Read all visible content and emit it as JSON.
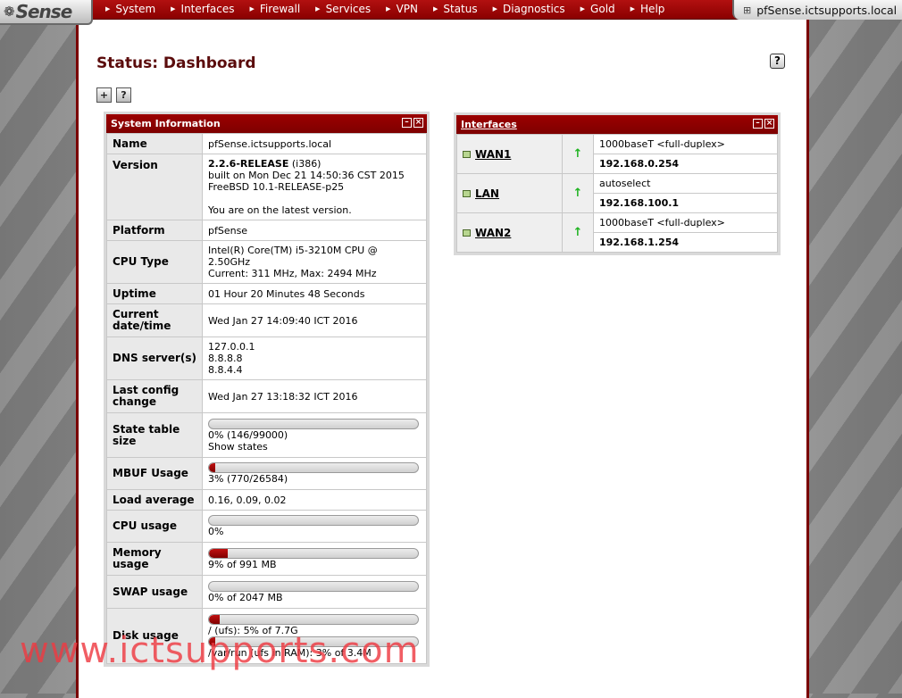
{
  "app": {
    "logo_text": "Sense",
    "hostname": "pfSense.ictsupports.local"
  },
  "nav": [
    "System",
    "Interfaces",
    "Firewall",
    "Services",
    "VPN",
    "Status",
    "Diagnostics",
    "Gold",
    "Help"
  ],
  "page": {
    "title": "Status: Dashboard"
  },
  "system_info": {
    "header": "System Information",
    "rows": {
      "name": {
        "label": "Name",
        "value": "pfSense.ictsupports.local"
      },
      "version": {
        "label": "Version",
        "release": "2.2.6-RELEASE",
        "arch": "(i386)",
        "built": "built on Mon Dec 21 14:50:36 CST 2015",
        "freebsd": "FreeBSD 10.1-RELEASE-p25",
        "status": "You are on the latest version."
      },
      "platform": {
        "label": "Platform",
        "value": "pfSense"
      },
      "cpu_type": {
        "label": "CPU Type",
        "line1": "Intel(R) Core(TM) i5-3210M CPU @ 2.50GHz",
        "line2": "Current: 311 MHz, Max: 2494 MHz"
      },
      "uptime": {
        "label": "Uptime",
        "value": "01 Hour 20 Minutes 48 Seconds"
      },
      "datetime": {
        "label": "Current date/time",
        "value": "Wed Jan 27 14:09:40 ICT 2016"
      },
      "dns": {
        "label": "DNS server(s)",
        "servers": [
          "127.0.0.1",
          "8.8.8.8",
          "8.8.4.4"
        ]
      },
      "last_config": {
        "label": "Last config change",
        "value": "Wed Jan 27 13:18:32 ICT 2016"
      },
      "state_table": {
        "label": "State table size",
        "percent": 0,
        "text": "0% (146/99000)",
        "link": "Show states"
      },
      "mbuf": {
        "label": "MBUF Usage",
        "percent": 3,
        "text": "3% (770/26584)"
      },
      "load": {
        "label": "Load average",
        "value": "0.16, 0.09, 0.02"
      },
      "cpu_usage": {
        "label": "CPU usage",
        "percent": 0,
        "text": "0%"
      },
      "memory": {
        "label": "Memory usage",
        "percent": 9,
        "text": "9% of 991 MB"
      },
      "swap": {
        "label": "SWAP usage",
        "percent": 0,
        "text": "0% of 2047 MB"
      },
      "disk": {
        "label": "Disk usage",
        "root_percent": 5,
        "root_text": "/ (ufs): 5% of 7.7G",
        "varrun_percent": 3,
        "varrun_text": "/var/run (ufs in RAM): 3% of 3.4M"
      }
    }
  },
  "interfaces": {
    "header": "Interfaces",
    "items": [
      {
        "name": "WAN1",
        "media": "1000baseT <full-duplex>",
        "ip": "192.168.0.254"
      },
      {
        "name": "LAN",
        "media": "autoselect",
        "ip": "192.168.100.1"
      },
      {
        "name": "WAN2",
        "media": "1000baseT <full-duplex>",
        "ip": "192.168.1.254"
      }
    ]
  },
  "watermark": "www.ictsupports.com",
  "colors": {
    "brand_red": "#8b0000",
    "status_up": "#1fb321"
  }
}
